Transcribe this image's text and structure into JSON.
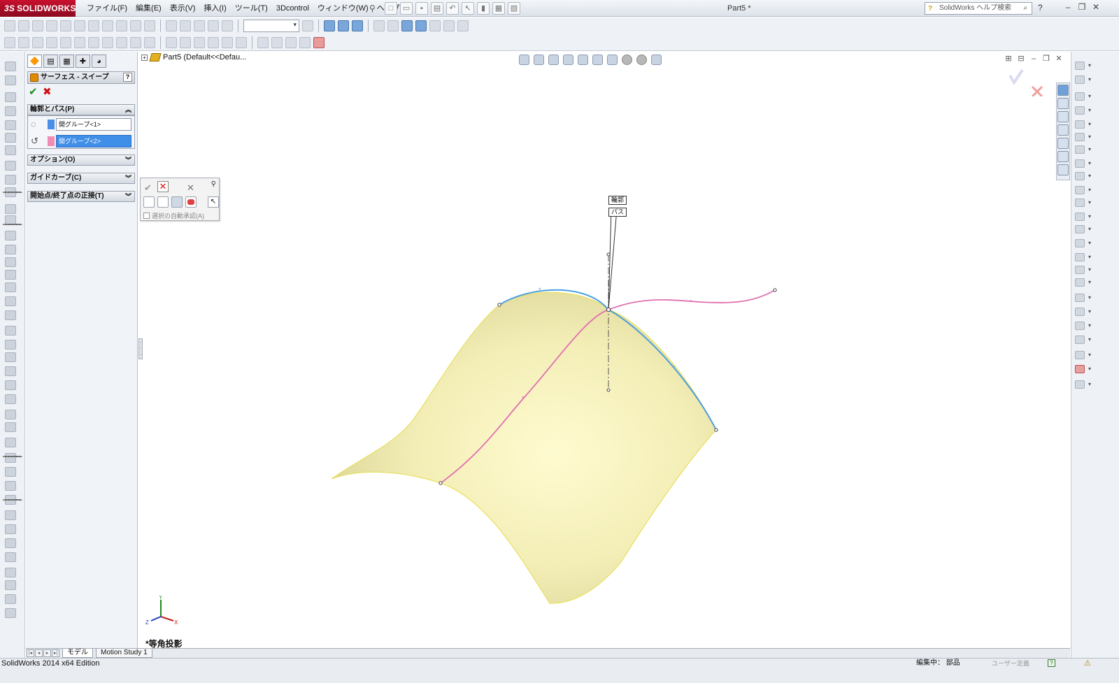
{
  "app": {
    "brand": "SOLIDWORKS",
    "brand_prefix": "3S",
    "document_title": "Part5 *",
    "help_search": "SolidWorks ヘルプ検索",
    "help_button": "?"
  },
  "menu": [
    "ファイル(F)",
    "編集(E)",
    "表示(V)",
    "挿入(I)",
    "ツール(T)",
    "3Dcontrol",
    "ウィンドウ(W)",
    "ヘルプ(H)"
  ],
  "property_manager": {
    "title": "サーフェス - スイープ",
    "help": "?",
    "sections": {
      "profile_path": "輪郭とパス(P)",
      "options": "オプション(O)",
      "guide_curves": "ガイドカーブ(C)",
      "tangency": "開始点/終了点の正接(T)"
    },
    "profile_field": "開グループ<1>",
    "path_field": "開グループ<2>",
    "profile_color": "#4a90e8",
    "path_color": "#f08cb4"
  },
  "viewport": {
    "tree_label": "Part5  (Default<<Defau...",
    "callout_profile": "輪郭",
    "callout_path": "パス",
    "view_orientation": "*等角投影",
    "triad": {
      "x": "X",
      "y": "Y",
      "z": "Z"
    },
    "selection_bar": {
      "auto_accept": "選択の自動承認(A)"
    },
    "surface_color": "#f4f0b8",
    "profile_curve_color": "#4a9ee0",
    "path_curve_color": "#e070b0"
  },
  "bottom_tabs": [
    "モデル",
    "Motion Study 1"
  ],
  "status": {
    "edition": "SolidWorks 2014 x64 Edition",
    "editing": "編集中： 部品",
    "units": "ユーザー定義",
    "help": "?"
  }
}
